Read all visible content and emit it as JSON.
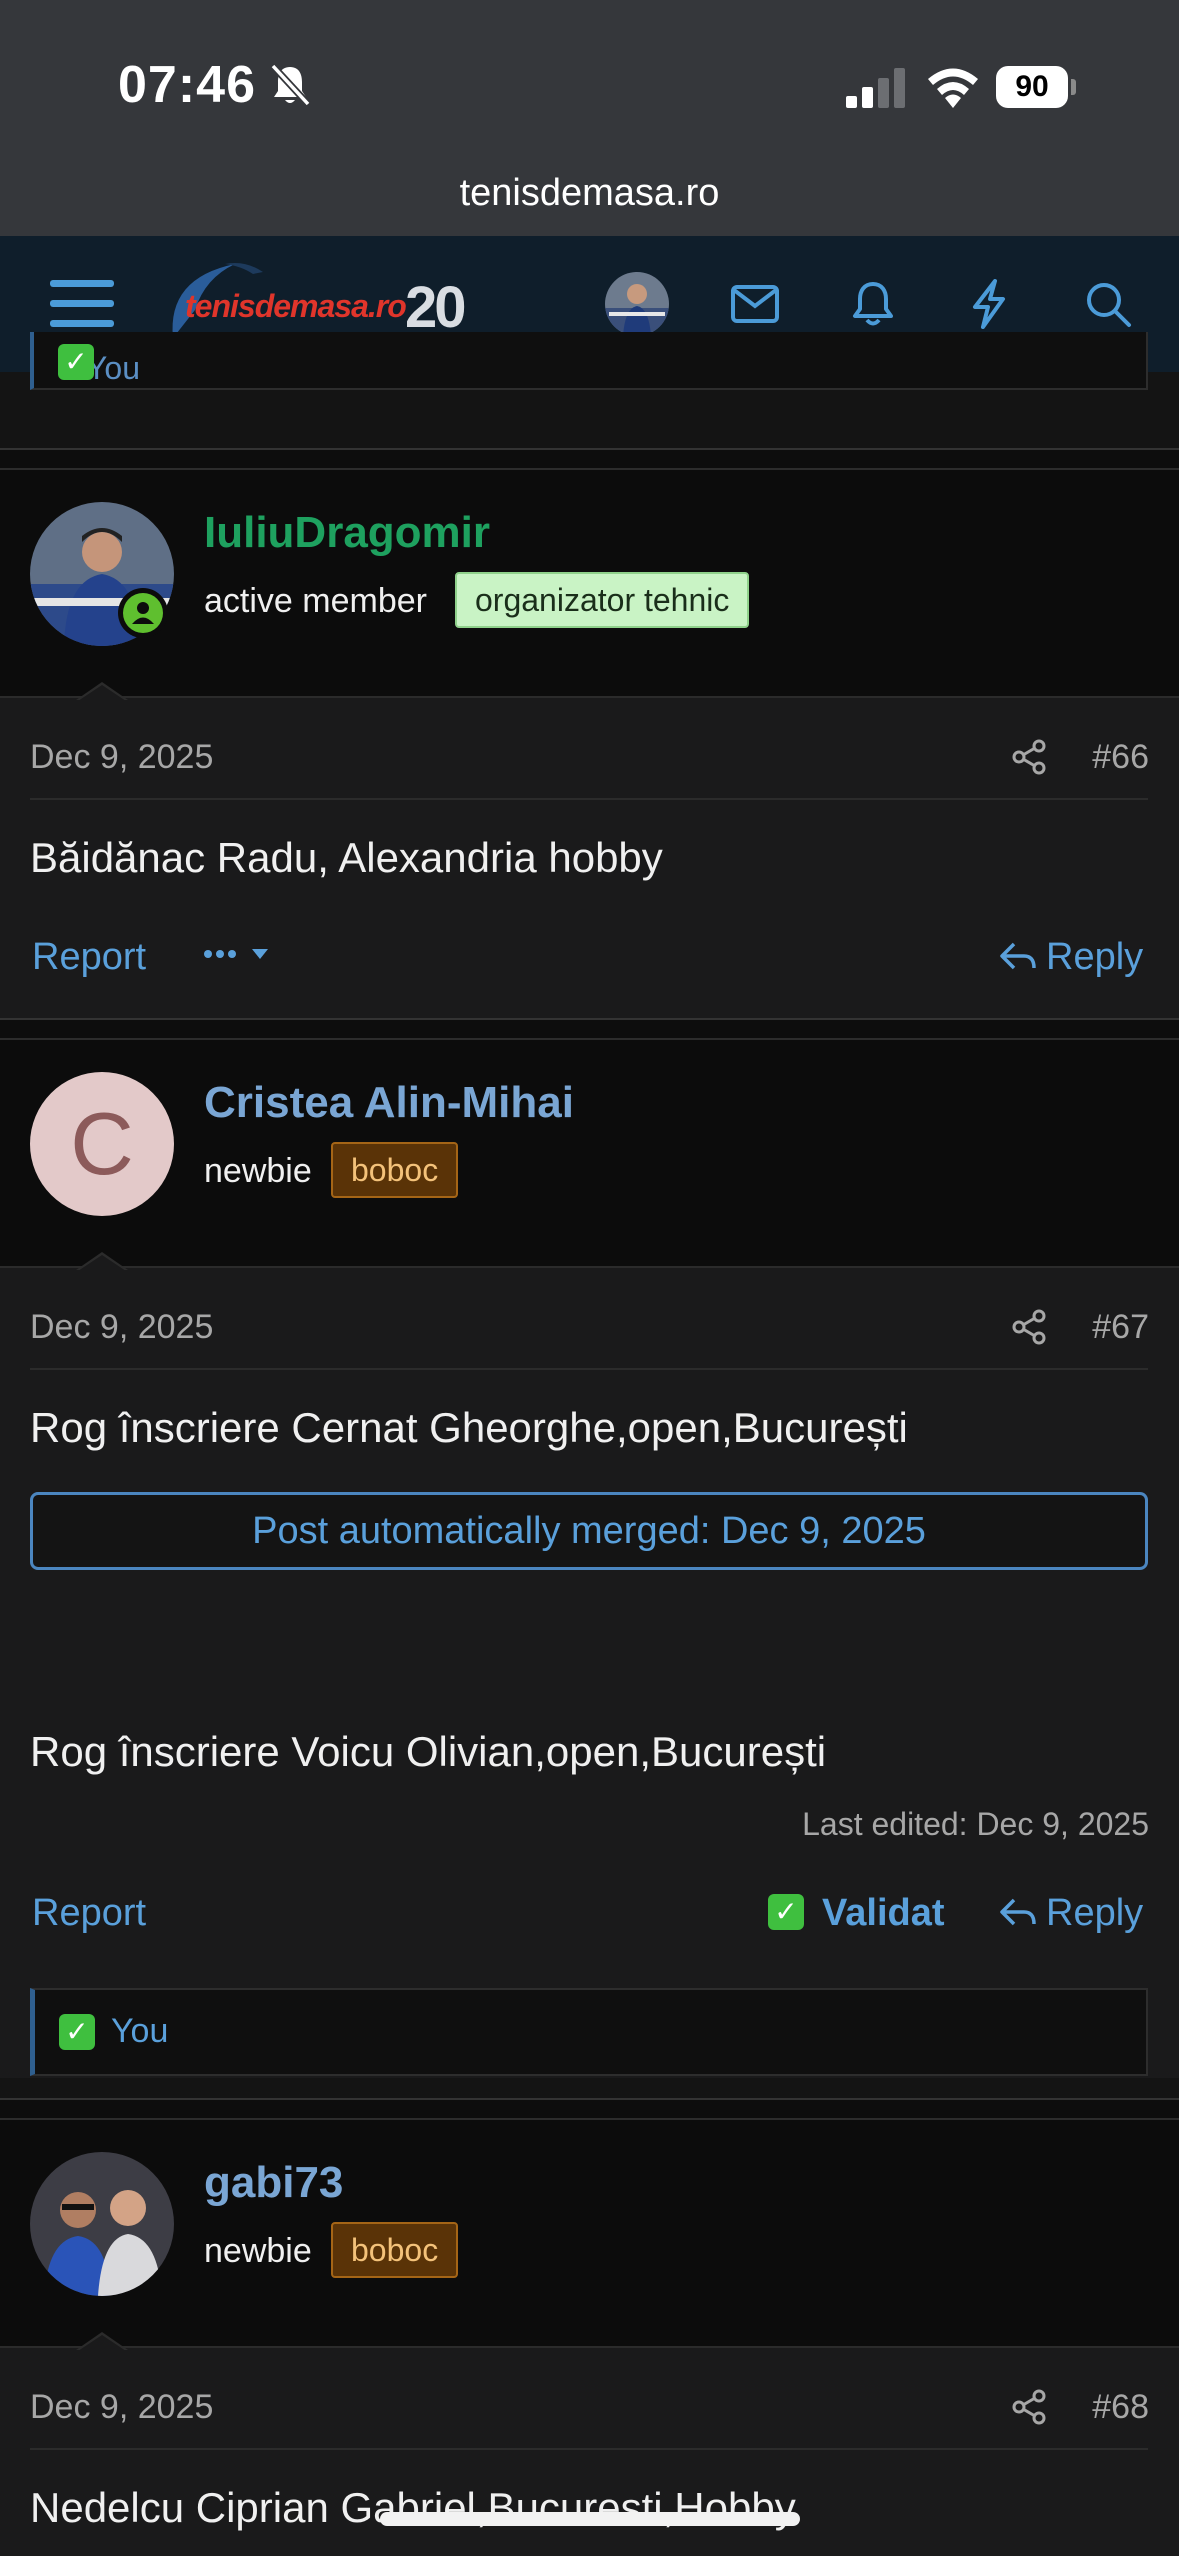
{
  "status": {
    "time": "07:46",
    "battery": "90"
  },
  "browser": {
    "url": "tenisdemasa.ro"
  },
  "header": {
    "logo_text": "tenisdemasa.ro",
    "logo_number": "20"
  },
  "prev_reaction": {
    "text": "You"
  },
  "posts": [
    {
      "username": "IuliuDragomir",
      "username_color": "#1ea15f",
      "user_title": "active member",
      "banner": "organizator tehnic",
      "date": "Dec 9, 2025",
      "number": "#66",
      "body": "Băidănac Radu, Alexandria hobby",
      "report": "Report",
      "reply": "Reply"
    },
    {
      "username": "Cristea Alin-Mihai",
      "username_color": "#7aa6d4",
      "avatar_letter": "C",
      "user_title": "newbie",
      "banner": "boboc",
      "date": "Dec 9, 2025",
      "number": "#67",
      "body": "Rog înscriere Cernat Gheorghe,open,București",
      "merged": "Post automatically merged: Dec 9, 2025",
      "body2": "Rog înscriere Voicu Olivian,open,București",
      "last_edited": "Last edited: Dec 9, 2025",
      "report": "Report",
      "validat": "Validat",
      "reply": "Reply",
      "reaction": "You"
    },
    {
      "username": "gabi73",
      "username_color": "#7aa6d4",
      "user_title": "newbie",
      "banner": "boboc",
      "date": "Dec 9, 2025",
      "number": "#68",
      "body": "Nedelcu Ciprian Gabriel,Bucuresti,Hobby"
    }
  ]
}
